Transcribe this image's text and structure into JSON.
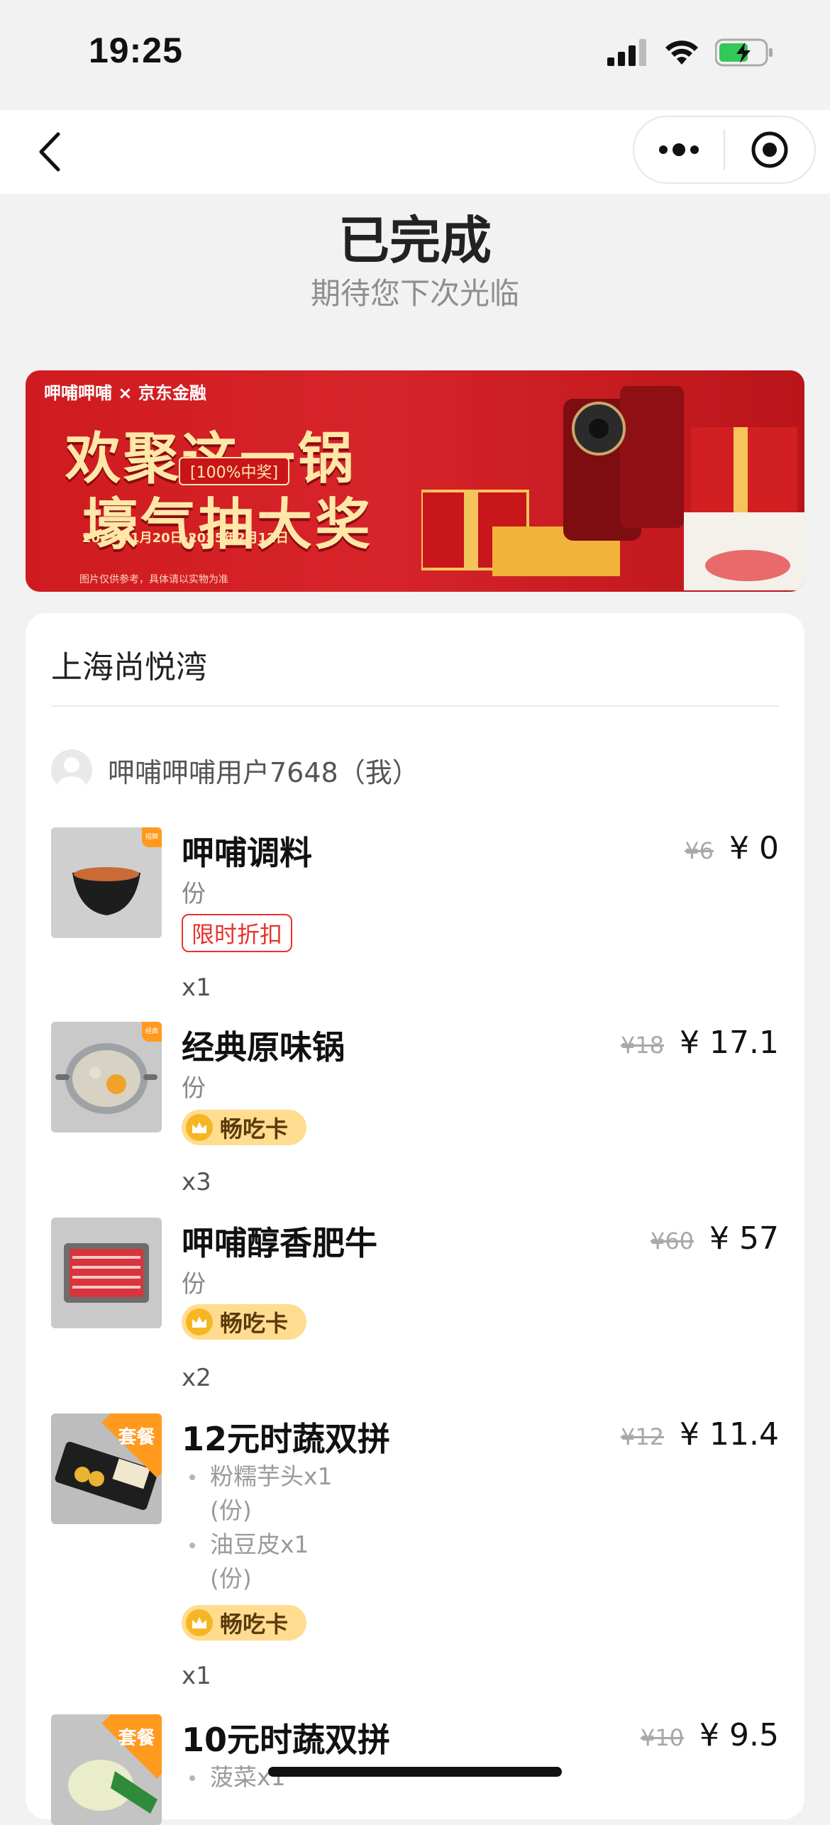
{
  "status_bar": {
    "time": "19:25"
  },
  "order": {
    "status_title": "已完成",
    "status_subtitle": "期待您下次光临"
  },
  "banner": {
    "brand": "呷哺呷哺 × 京东金融",
    "headline_1": "欢聚这一锅",
    "headline_2": "壕气抽大奖",
    "tag": "[100%中奖]",
    "date_range": "2025年1月20日-2025年2月12日",
    "note": "图片仅供参考，具体请以实物为准"
  },
  "store": {
    "name": "上海尚悦湾"
  },
  "user": {
    "name": "呷哺呷哺用户7648（我）"
  },
  "items": [
    {
      "name": "呷哺调料",
      "unit": "份",
      "old_price": "¥6",
      "price": "¥ 0",
      "tag": "限时折扣",
      "qty": "x1",
      "corner": "招牌"
    },
    {
      "name": "经典原味锅",
      "unit": "份",
      "old_price": "¥18",
      "price": "¥ 17.1",
      "tag": "畅吃卡",
      "qty": "x3",
      "corner": "经典"
    },
    {
      "name": "呷哺醇香肥牛",
      "unit": "份",
      "old_price": "¥60",
      "price": "¥ 57",
      "tag": "畅吃卡",
      "qty": "x2"
    },
    {
      "name": "12元时蔬双拼",
      "old_price": "¥12",
      "price": "¥ 11.4",
      "tag": "畅吃卡",
      "qty": "x1",
      "corner": "套餐",
      "sub_items": [
        {
          "name": "粉糯芋头x1",
          "unit": "(份)"
        },
        {
          "name": "油豆皮x1",
          "unit": "(份)"
        }
      ]
    },
    {
      "name": "10元时蔬双拼",
      "old_price": "¥10",
      "price": "¥ 9.5",
      "corner": "套餐",
      "sub_items": [
        {
          "name": "菠菜x1"
        }
      ]
    }
  ],
  "colors": {
    "accent_red": "#e8322d",
    "badge_yellow": "#ffdc8f",
    "corner_orange": "#ff9a1f"
  }
}
